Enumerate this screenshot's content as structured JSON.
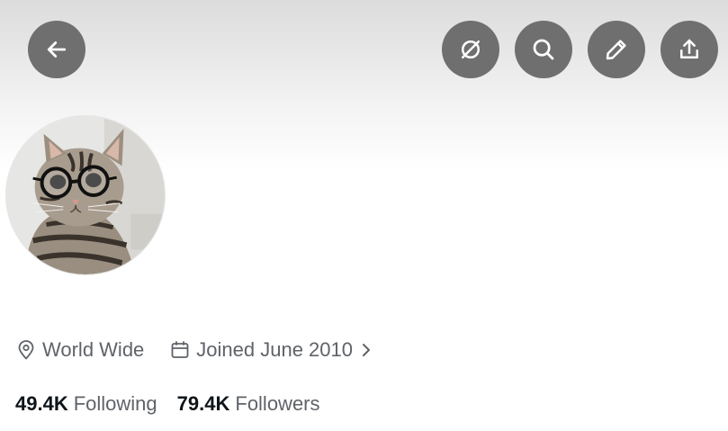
{
  "header": {
    "buttons": [
      {
        "name": "back",
        "icon": "arrow-left-icon"
      },
      {
        "name": "grok",
        "icon": "slashed-circle-icon"
      },
      {
        "name": "search",
        "icon": "search-icon"
      },
      {
        "name": "edit",
        "icon": "pencil-icon"
      },
      {
        "name": "share",
        "icon": "upload-icon"
      }
    ],
    "button_color": "#6f6f6f"
  },
  "profile": {
    "avatar": "cat-with-glasses-avatar",
    "location": "World Wide",
    "joined": "Joined June 2010"
  },
  "stats": {
    "following_count": "49.4K",
    "following_label": "Following",
    "followers_count": "79.4K",
    "followers_label": "Followers"
  }
}
